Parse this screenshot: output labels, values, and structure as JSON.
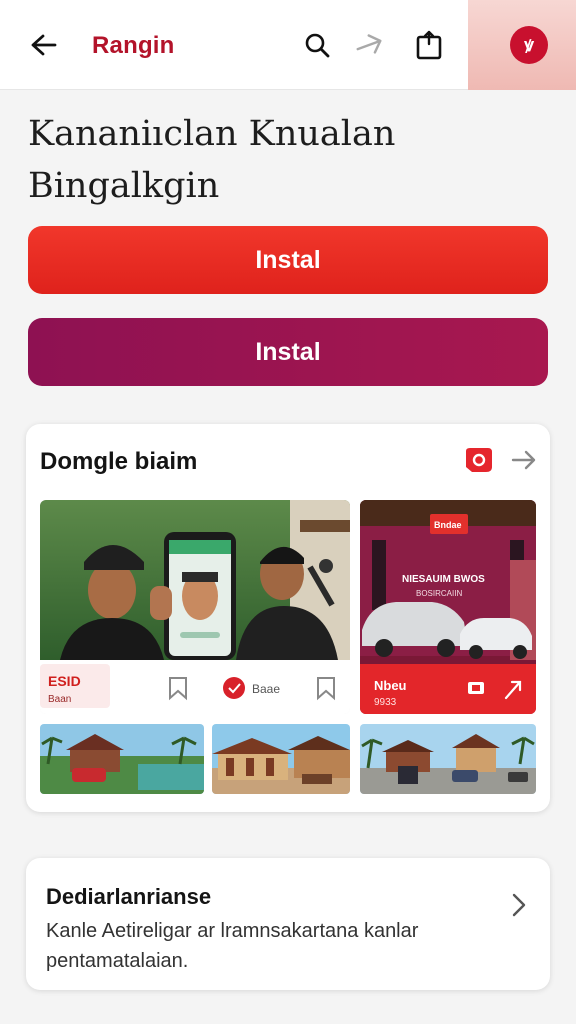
{
  "header": {
    "brand": "Rangin",
    "icons": [
      "back-arrow-icon",
      "search-icon",
      "share-plane-icon",
      "share-box-icon",
      "profile-avatar-icon"
    ],
    "avatar_glyph": "ꝟ",
    "colors": {
      "brand": "#b3132a",
      "avatar": "#c8102e"
    }
  },
  "page": {
    "title": "Kananiıclan Knualan Bingalkgin"
  },
  "actions": {
    "primary_label": "Instal",
    "secondary_label": "Instal",
    "colors": {
      "primary": "#e62a22",
      "secondary": "#9b1450"
    }
  },
  "gallery": {
    "title": "Domgle biaim",
    "main_tile": {
      "badge_big": "ESID",
      "badge_small": "Baan",
      "action_label": "Baae"
    },
    "side_tile": {
      "banner_sign": "Bndae",
      "banner_line1": "NIESAUIM BWOS",
      "banner_line2": "BOSIRCAIIN",
      "footer_title": "Nbeu",
      "footer_sub": "9933"
    }
  },
  "info": {
    "title": "Dediarlanrianse",
    "description": "Kanle Aetireligar ar lramnsakartana kanlar pentamatalaian."
  }
}
